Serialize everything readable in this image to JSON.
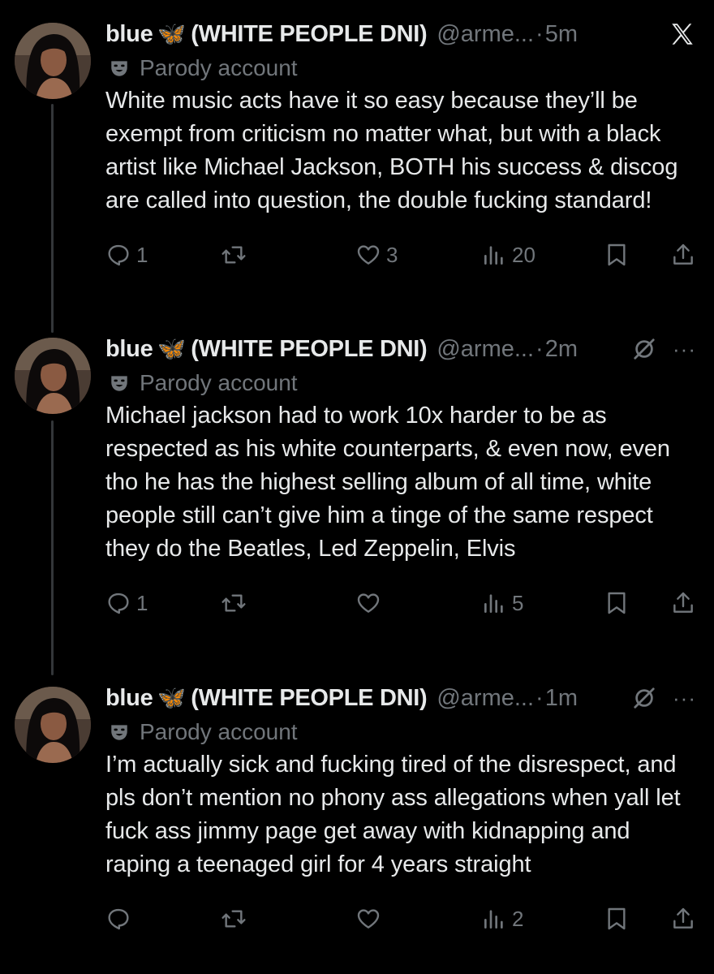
{
  "account": {
    "display_name": "blue",
    "butterfly_icon": "🦋",
    "name_suffix": "(WHITE PEOPLE DNI)",
    "handle": "@arme...",
    "label": "Parody account",
    "label_icon": "mask-icon"
  },
  "colors": {
    "background": "#000000",
    "text": "#e7e9ea",
    "muted": "#71767b",
    "thread_line": "#333639",
    "butterfly": "#4aa8ff"
  },
  "tweets": [
    {
      "time": "5m",
      "text": "White music acts have it so easy because they’ll be exempt from criticism no matter what, but with a black artist like Michael Jackson, BOTH his success & discog are called into question, the double fucking standard!",
      "replies": "1",
      "reposts": "",
      "likes": "3",
      "views": "20"
    },
    {
      "time": "2m",
      "text": "Michael jackson had to work 10x harder to be as respected as his white counterparts, & even now, even tho he has the highest selling album of all time, white people still can’t give him a tinge of the same respect they do the Beatles, Led Zeppelin, Elvis",
      "replies": "1",
      "reposts": "",
      "likes": "",
      "views": "5"
    },
    {
      "time": "1m",
      "text": "I’m actually sick and fucking tired of the disrespect, and pls don’t mention no phony ass allegations when yall let fuck ass jimmy page get away with kidnapping and raping a teenaged girl for 4 years straight",
      "replies": "",
      "reposts": "",
      "likes": "",
      "views": "2"
    }
  ],
  "header": {
    "dot": "·",
    "more": "···"
  }
}
